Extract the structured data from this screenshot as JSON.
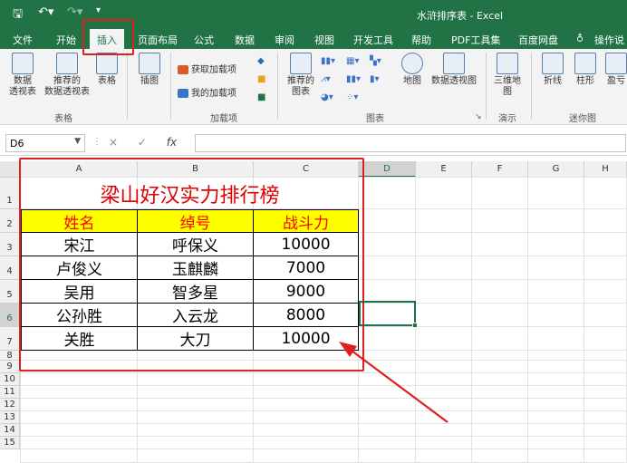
{
  "window": {
    "title": "水浒排序表 - Excel"
  },
  "quick_access": {
    "save_icon": "save-icon",
    "undo_icon": "undo-icon",
    "redo_icon": "redo-icon",
    "customize_icon": "customize-icon"
  },
  "tabs": [
    {
      "label": "文件"
    },
    {
      "label": "开始"
    },
    {
      "label": "插入"
    },
    {
      "label": "页面布局"
    },
    {
      "label": "公式"
    },
    {
      "label": "数据"
    },
    {
      "label": "审阅"
    },
    {
      "label": "视图"
    },
    {
      "label": "开发工具"
    },
    {
      "label": "帮助"
    },
    {
      "label": "PDF工具集"
    },
    {
      "label": "百度网盘"
    },
    {
      "label": "操作说"
    }
  ],
  "tell_me_icon": "lightbulb-icon",
  "ribbon": {
    "pivot": "数据\n透视表",
    "recommended_pivot": "推荐的\n数据透视表",
    "table": "表格",
    "group_tables": "表格",
    "illustrations": "插图",
    "get_addins": "获取加载项",
    "my_addins": "我的加载项",
    "group_addins": "加载项",
    "recommended_charts": "推荐的\n图表",
    "map": "地图",
    "pivot_chart": "数据透视图",
    "group_charts": "图表",
    "map3d": "三维地\n图",
    "group_tours": "演示",
    "line": "折线",
    "column": "柱形",
    "winloss": "盈亏",
    "group_sparklines": "迷你图"
  },
  "formula_bar": {
    "name_box": "D6",
    "cancel": "×",
    "enter": "✓",
    "fx": "fx",
    "value": ""
  },
  "columns": [
    "A",
    "B",
    "C",
    "D",
    "E",
    "F",
    "G",
    "H"
  ],
  "rows": [
    "1",
    "2",
    "3",
    "4",
    "5",
    "6",
    "7",
    "8",
    "9",
    "10",
    "11",
    "12",
    "13",
    "14",
    "15"
  ],
  "sheet": {
    "title": "梁山好汉实力排行榜",
    "headers": [
      "姓名",
      "绰号",
      "战斗力"
    ],
    "data": [
      [
        "宋江",
        "呼保义",
        "10000"
      ],
      [
        "卢俊义",
        "玉麒麟",
        "7000"
      ],
      [
        "吴用",
        "智多星",
        "9000"
      ],
      [
        "公孙胜",
        "入云龙",
        "8000"
      ],
      [
        "关胜",
        "大刀",
        "10000"
      ]
    ]
  },
  "colors": {
    "excel_green": "#217346",
    "title_red": "#e00000",
    "header_fill": "#ffff00",
    "header_text": "#ff0000",
    "annotation_red": "#e02020"
  }
}
